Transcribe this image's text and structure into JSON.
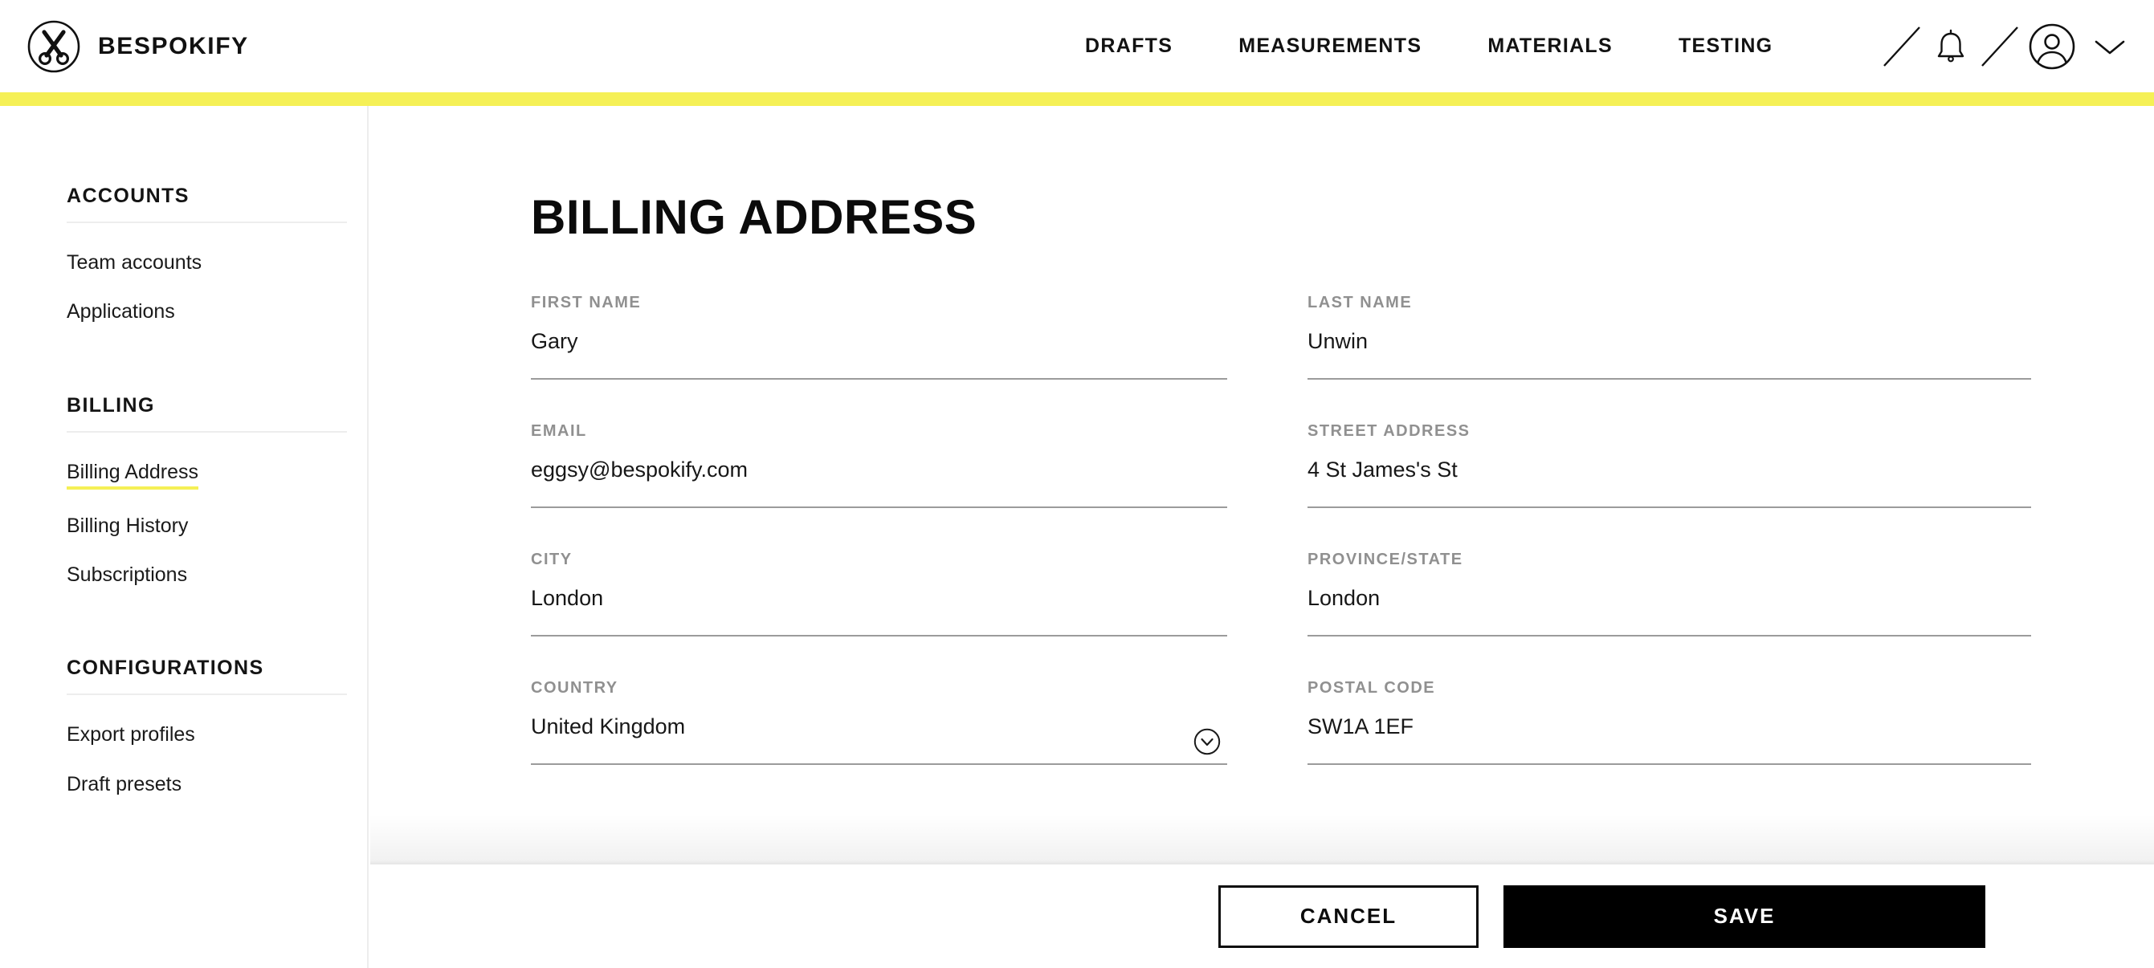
{
  "brand": {
    "name": "BESPOKIFY",
    "logo_icon": "scissors-in-circle-icon"
  },
  "topnav": {
    "items": [
      {
        "label": "DRAFTS"
      },
      {
        "label": "MEASUREMENTS"
      },
      {
        "label": "MATERIALS"
      },
      {
        "label": "TESTING"
      }
    ],
    "icons": [
      {
        "name": "diagonal-separator-icon"
      },
      {
        "name": "bell-icon"
      },
      {
        "name": "diagonal-separator-icon"
      },
      {
        "name": "user-avatar-icon"
      },
      {
        "name": "chevron-down-icon"
      }
    ]
  },
  "theme": {
    "accent": "#f5f056",
    "text": "#111111",
    "label": "#909090",
    "rule": "#9b9b9b",
    "divider": "#ededed",
    "save_bg": "#000000"
  },
  "sidebar": {
    "sections": [
      {
        "heading": "ACCOUNTS",
        "items": [
          {
            "label": "Team accounts",
            "active": false
          },
          {
            "label": "Applications",
            "active": false
          }
        ]
      },
      {
        "heading": "BILLING",
        "items": [
          {
            "label": "Billing Address",
            "active": true
          },
          {
            "label": "Billing History",
            "active": false
          },
          {
            "label": "Subscriptions",
            "active": false
          }
        ]
      },
      {
        "heading": "CONFIGURATIONS",
        "items": [
          {
            "label": "Export profiles",
            "active": false
          },
          {
            "label": "Draft presets",
            "active": false
          }
        ]
      }
    ]
  },
  "main": {
    "title": "BILLING ADDRESS",
    "fields": {
      "first_name": {
        "label": "FIRST NAME",
        "value": "Gary",
        "placeholder": "First name"
      },
      "last_name": {
        "label": "LAST NAME",
        "value": "Unwin",
        "placeholder": "Last name"
      },
      "email": {
        "label": "EMAIL",
        "value": "eggsy@bespokify.com",
        "placeholder": "Email"
      },
      "street_address": {
        "label": "STREET ADDRESS",
        "value": "4 St James's St",
        "placeholder": "Street address"
      },
      "city": {
        "label": "CITY",
        "value": "London",
        "placeholder": "City"
      },
      "province_state": {
        "label": "PROVINCE/STATE",
        "value": "London",
        "placeholder": "Province/State"
      },
      "country": {
        "label": "COUNTRY",
        "value": "United Kingdom",
        "placeholder": "Country",
        "caret_icon": "chevron-down-circle-icon"
      },
      "postal_code": {
        "label": "POSTAL CODE",
        "value": "SW1A 1EF",
        "placeholder": "Postal code"
      }
    }
  },
  "footer": {
    "cancel_label": "CANCEL",
    "save_label": "SAVE"
  }
}
